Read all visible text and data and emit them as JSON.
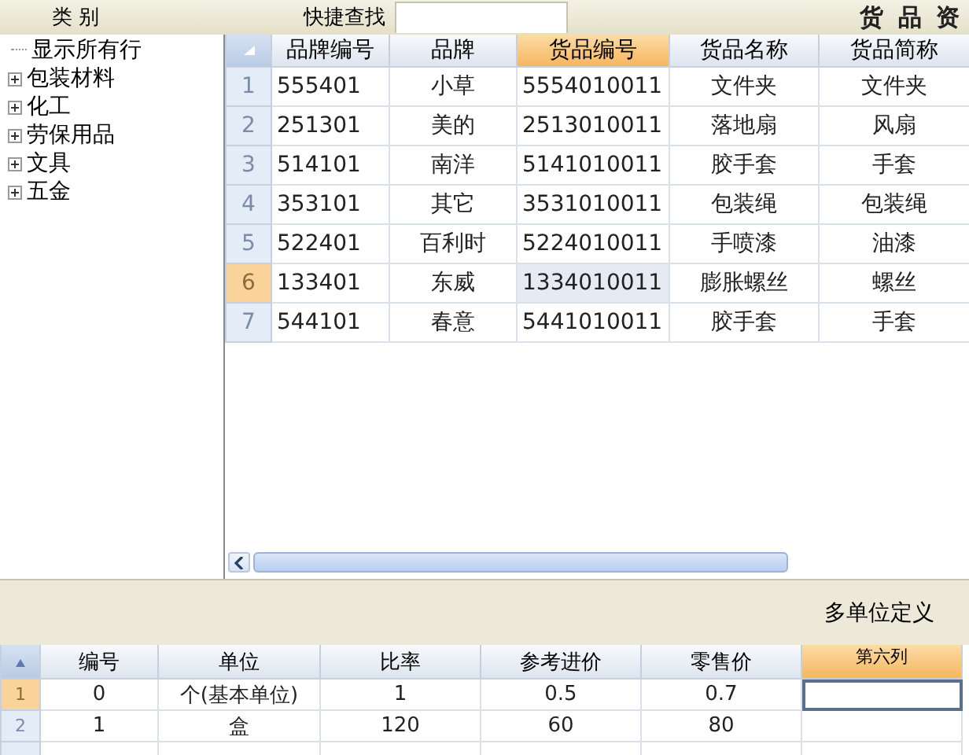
{
  "top_bar": {
    "category_label": "类 别",
    "search_label": "快捷查找",
    "title": "货 品 资"
  },
  "tree": {
    "items": [
      {
        "label": "显示所有行",
        "kind": "leaf"
      },
      {
        "label": "包装材料",
        "kind": "group",
        "expanded": false
      },
      {
        "label": "化工",
        "kind": "group",
        "expanded": false
      },
      {
        "label": "劳保用品",
        "kind": "group",
        "expanded": false
      },
      {
        "label": "文具",
        "kind": "group",
        "expanded": false
      },
      {
        "label": "五金",
        "kind": "group",
        "expanded": false
      }
    ]
  },
  "goods_table": {
    "columns": [
      {
        "label": "品牌编号",
        "selected": false,
        "kind": "code"
      },
      {
        "label": "品牌",
        "selected": false,
        "kind": "text"
      },
      {
        "label": "货品编号",
        "selected": true,
        "kind": "code"
      },
      {
        "label": "货品名称",
        "selected": false,
        "kind": "text"
      },
      {
        "label": "货品简称",
        "selected": false,
        "kind": "text"
      }
    ],
    "rows": [
      {
        "number": "1",
        "selected": false,
        "cells": [
          "555401",
          "小草",
          "5554010011",
          "文件夹",
          "文件夹"
        ]
      },
      {
        "number": "2",
        "selected": false,
        "cells": [
          "251301",
          "美的",
          "2513010011",
          "落地扇",
          "风扇"
        ]
      },
      {
        "number": "3",
        "selected": false,
        "cells": [
          "514101",
          "南洋",
          "5141010011",
          "胶手套",
          "手套"
        ]
      },
      {
        "number": "4",
        "selected": false,
        "cells": [
          "353101",
          "其它",
          "3531010011",
          "包装绳",
          "包装绳"
        ]
      },
      {
        "number": "5",
        "selected": false,
        "cells": [
          "522401",
          "百利时",
          "5224010011",
          "手喷漆",
          "油漆"
        ]
      },
      {
        "number": "6",
        "selected": true,
        "cells": [
          "133401",
          "东威",
          "1334010011",
          "膨胀螺丝",
          "螺丝"
        ]
      },
      {
        "number": "7",
        "selected": false,
        "cells": [
          "544101",
          "春意",
          "5441010011",
          "胶手套",
          "手套"
        ]
      }
    ]
  },
  "units_section": {
    "title": "多单位定义"
  },
  "units_table": {
    "columns": [
      {
        "label": "编号",
        "selected": false
      },
      {
        "label": "单位",
        "selected": false
      },
      {
        "label": "比率",
        "selected": false
      },
      {
        "label": "参考进价",
        "selected": false
      },
      {
        "label": "零售价",
        "selected": false
      },
      {
        "label": "第六列",
        "selected": true
      }
    ],
    "rows": [
      {
        "number": "1",
        "selected": true,
        "cells": [
          "0",
          "个(基本单位)",
          "1",
          "0.5",
          "0.7",
          ""
        ]
      },
      {
        "number": "2",
        "selected": false,
        "cells": [
          "1",
          "盒",
          "120",
          "60",
          "80",
          ""
        ]
      }
    ]
  }
}
